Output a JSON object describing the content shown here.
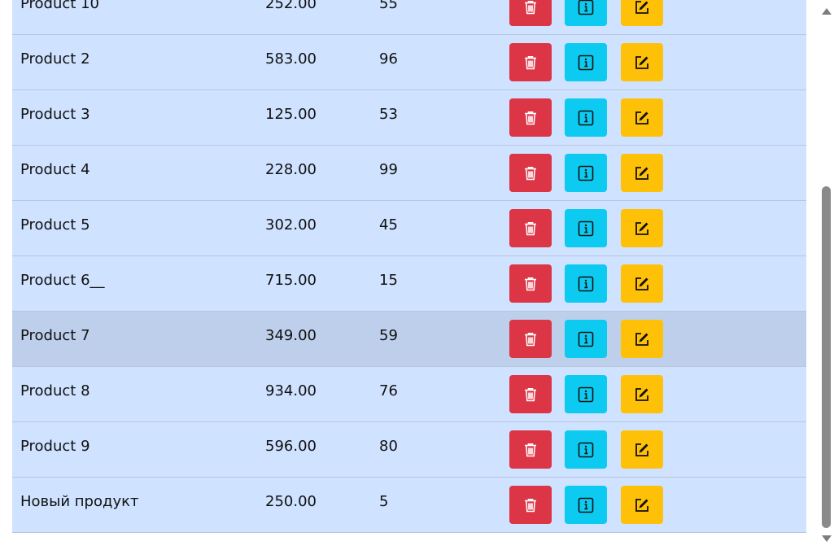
{
  "table": {
    "rows": [
      {
        "name": "Product 10",
        "price": "252.00",
        "qty": "55"
      },
      {
        "name": "Product 2",
        "price": "583.00",
        "qty": "96"
      },
      {
        "name": "Product 3",
        "price": "125.00",
        "qty": "53"
      },
      {
        "name": "Product 4",
        "price": "228.00",
        "qty": "99"
      },
      {
        "name": "Product 5",
        "price": "302.00",
        "qty": "45"
      },
      {
        "name": "Product 6__",
        "price": "715.00",
        "qty": "15"
      },
      {
        "name": "Product 7",
        "price": "349.00",
        "qty": "59"
      },
      {
        "name": "Product 8",
        "price": "934.00",
        "qty": "76"
      },
      {
        "name": "Product 9",
        "price": "596.00",
        "qty": "80"
      },
      {
        "name": "Новый продукт",
        "price": "250.00",
        "qty": "5"
      }
    ],
    "hovered_row": 6,
    "actions": [
      {
        "icon": "trash-icon",
        "color": "#dc3545"
      },
      {
        "icon": "info-icon",
        "color": "#0dcaf0"
      },
      {
        "icon": "edit-icon",
        "color": "#ffc107"
      }
    ]
  },
  "colors": {
    "row_background": "#cfe2ff",
    "row_hover_background": "#bdcfeb",
    "delete": "#dc3545",
    "info": "#0dcaf0",
    "edit": "#ffc107"
  }
}
